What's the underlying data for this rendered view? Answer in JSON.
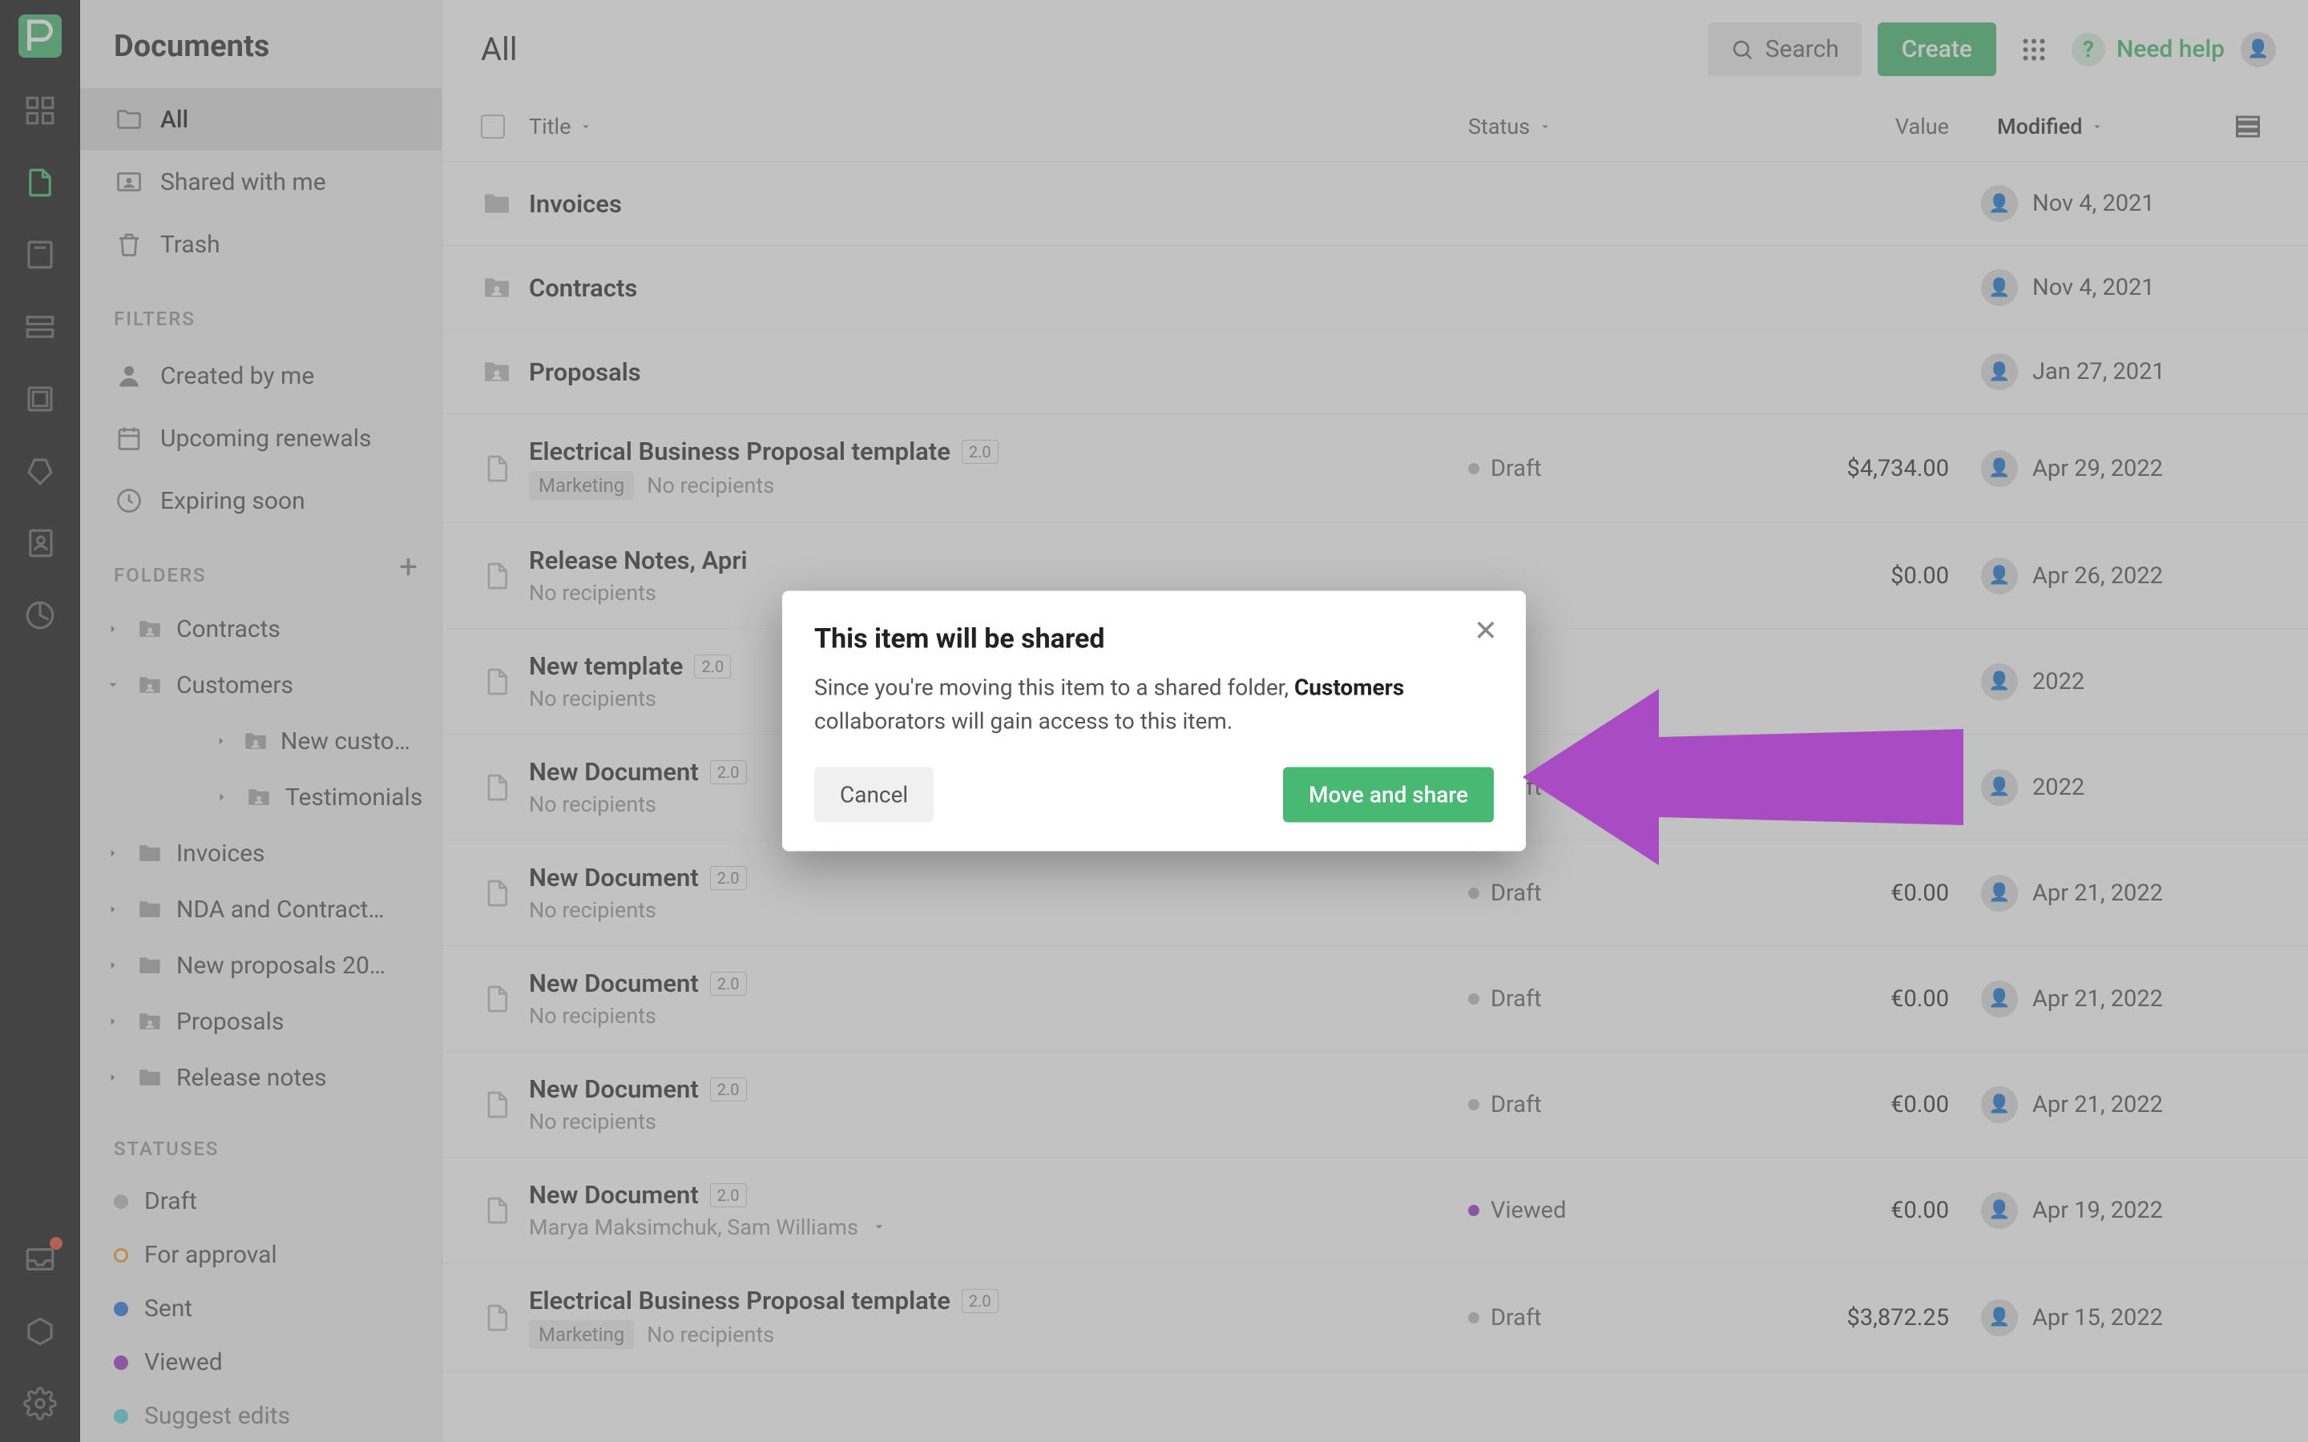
{
  "app": {
    "rail_logo_letters": "pd"
  },
  "sidebar": {
    "title": "Documents",
    "nav": [
      {
        "label": "All",
        "icon": "folder"
      },
      {
        "label": "Shared with me",
        "icon": "shared"
      },
      {
        "label": "Trash",
        "icon": "trash"
      }
    ],
    "filters_label": "FILTERS",
    "filters": [
      {
        "label": "Created by me",
        "icon": "person"
      },
      {
        "label": "Upcoming renewals",
        "icon": "calendar"
      },
      {
        "label": "Expiring soon",
        "icon": "clock"
      }
    ],
    "folders_label": "FOLDERS",
    "folders": [
      {
        "label": "Contracts",
        "icon": "shared-folder",
        "level": 0,
        "expanded": false
      },
      {
        "label": "Customers",
        "icon": "shared-folder",
        "level": 0,
        "expanded": true
      },
      {
        "label": "New custome…",
        "icon": "shared-folder",
        "level": 1,
        "expanded": false
      },
      {
        "label": "Testimonials",
        "icon": "shared-folder",
        "level": 1,
        "expanded": false
      },
      {
        "label": "Invoices",
        "icon": "folder",
        "level": 0,
        "expanded": false
      },
      {
        "label": "NDA and Contract…",
        "icon": "folder",
        "level": 0,
        "expanded": false
      },
      {
        "label": "New proposals 20…",
        "icon": "folder",
        "level": 0,
        "expanded": false
      },
      {
        "label": "Proposals",
        "icon": "shared-folder",
        "level": 0,
        "expanded": false
      },
      {
        "label": "Release notes",
        "icon": "folder",
        "level": 0,
        "expanded": false
      }
    ],
    "statuses_label": "STATUSES",
    "statuses": [
      {
        "label": "Draft",
        "color": "#bdbdbd"
      },
      {
        "label": "For approval",
        "color_ring": "#f0a02e"
      },
      {
        "label": "Sent",
        "color": "#2f7de1"
      },
      {
        "label": "Viewed",
        "color": "#9b3cc9"
      },
      {
        "label": "Suggest edits",
        "color": "#2fc4d6",
        "truncated": true
      }
    ]
  },
  "topbar": {
    "page_title": "All",
    "search_label": "Search",
    "create_label": "Create",
    "help_label": "Need help"
  },
  "columns": {
    "title": "Title",
    "status": "Status",
    "value": "Value",
    "modified": "Modified"
  },
  "rows": [
    {
      "type": "folder",
      "title": "Invoices",
      "modified": "Nov 4, 2021"
    },
    {
      "type": "folder-shared",
      "title": "Contracts",
      "modified": "Nov 4, 2021"
    },
    {
      "type": "folder-shared",
      "title": "Proposals",
      "modified": "Jan 27, 2021"
    },
    {
      "type": "doc",
      "title": "Electrical Business Proposal template",
      "badge": "2.0",
      "tag": "Marketing",
      "recipients": "No recipients",
      "status": "Draft",
      "status_color": "#bdbdbd",
      "value": "$4,734.00",
      "modified": "Apr 29, 2022"
    },
    {
      "type": "doc",
      "title": "Release Notes, Apri",
      "recipients": "No recipients",
      "value": "$0.00",
      "modified": "Apr 26, 2022"
    },
    {
      "type": "doc",
      "title": "New template",
      "badge": "2.0",
      "recipients": "No recipients",
      "modified_partial": "2022"
    },
    {
      "type": "doc",
      "title": "New Document",
      "badge": "2.0",
      "recipients": "No recipients",
      "status": "Draft",
      "status_color": "#bdbdbd",
      "modified_partial": "2022"
    },
    {
      "type": "doc",
      "title": "New Document",
      "badge": "2.0",
      "recipients": "No recipients",
      "status": "Draft",
      "status_color": "#bdbdbd",
      "value": "€0.00",
      "modified": "Apr 21, 2022"
    },
    {
      "type": "doc",
      "title": "New Document",
      "badge": "2.0",
      "recipients": "No recipients",
      "status": "Draft",
      "status_color": "#bdbdbd",
      "value": "€0.00",
      "modified": "Apr 21, 2022"
    },
    {
      "type": "doc",
      "title": "New Document",
      "badge": "2.0",
      "recipients": "No recipients",
      "status": "Draft",
      "status_color": "#bdbdbd",
      "value": "€0.00",
      "modified": "Apr 21, 2022"
    },
    {
      "type": "doc",
      "title": "New Document",
      "badge": "2.0",
      "recipients": "Marya Maksimchuk, Sam Williams",
      "recipients_expand": true,
      "status": "Viewed",
      "status_color": "#9b3cc9",
      "value": "€0.00",
      "modified": "Apr 19, 2022"
    },
    {
      "type": "doc",
      "title": "Electrical Business Proposal template",
      "badge": "2.0",
      "tag": "Marketing",
      "recipients": "No recipients",
      "status": "Draft",
      "status_color": "#bdbdbd",
      "value": "$3,872.25",
      "modified": "Apr 15, 2022"
    }
  ],
  "modal": {
    "title": "This item will be shared",
    "body_pre": "Since you're moving this item to a shared folder, ",
    "body_bold": "Customers",
    "body_post": " collaborators will gain access to this item.",
    "cancel": "Cancel",
    "confirm": "Move and share"
  }
}
